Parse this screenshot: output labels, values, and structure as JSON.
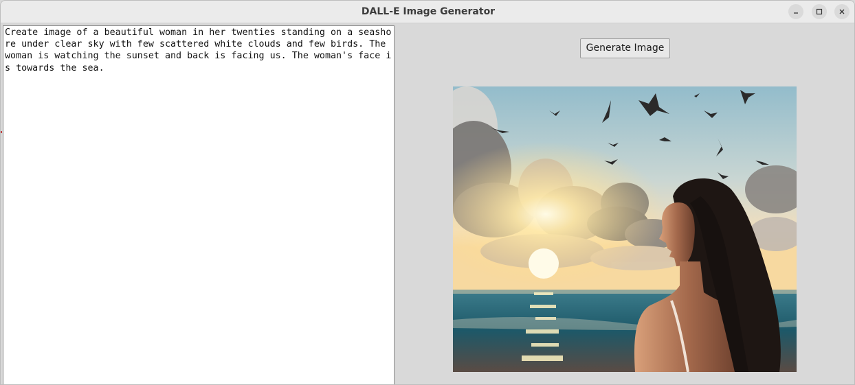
{
  "window": {
    "title": "DALL-E Image Generator",
    "controls": {
      "minimize": "minimize-icon",
      "maximize": "maximize-icon",
      "close": "close-icon"
    }
  },
  "prompt": {
    "text": "Create image of a beautiful woman in her twenties standing on a seashore under clear sky with few scattered white clouds and few birds. The woman is watching the sunset and back is facing us. The woman's face is towards the sea."
  },
  "toolbar": {
    "generate_label": "Generate Image"
  },
  "colors": {
    "window_bg": "#d9d9d9",
    "titlebar_bg": "#ebebeb",
    "sky_top": "#8fb9c8",
    "sun": "#fff2c0",
    "sea": "#1f5f70"
  }
}
